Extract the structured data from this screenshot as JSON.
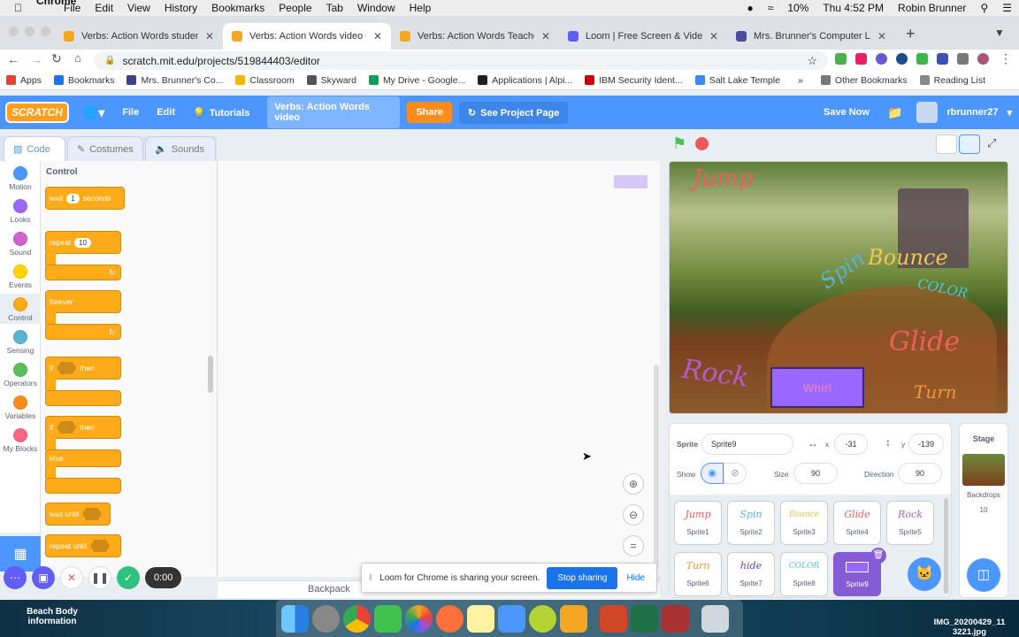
{
  "menubar": {
    "app": "Chrome",
    "items": [
      "File",
      "Edit",
      "View",
      "History",
      "Bookmarks",
      "People",
      "Tab",
      "Window",
      "Help"
    ],
    "battery": "10%",
    "clock": "Thu 4:52 PM",
    "user": "Robin Brunner"
  },
  "tabs": [
    {
      "title": "Verbs: Action Words student o",
      "color": "#f5a623"
    },
    {
      "title": "Verbs: Action Words video on",
      "color": "#f5a623"
    },
    {
      "title": "Verbs: Action Words Teacher o",
      "color": "#f5a623"
    },
    {
      "title": "Loom | Free Screen & Video Re",
      "color": "#625df5"
    },
    {
      "title": "Mrs. Brunner's Computer Lab",
      "color": "#4c4c9e"
    }
  ],
  "url": "scratch.mit.edu/projects/519844403/editor",
  "bookmarks": [
    "Apps",
    "Bookmarks",
    "Mrs. Brunner's Co...",
    "Classroom",
    "Skyward",
    "My Drive - Google...",
    "Applications | Alpi...",
    "IBM Security Ident...",
    "Salt Lake Temple",
    "Other Bookmarks",
    "Reading List"
  ],
  "scratch": {
    "logo": "SCRATCH",
    "file": "File",
    "edit": "Edit",
    "tutorials": "Tutorials",
    "project_title": "Verbs: Action Words video",
    "share": "Share",
    "see_project": "See Project Page",
    "save": "Save Now",
    "username": "rbrunner27"
  },
  "editor_tabs": {
    "code": "Code",
    "costumes": "Costumes",
    "sounds": "Sounds"
  },
  "categories": [
    {
      "label": "Motion",
      "color": "#4c97ff"
    },
    {
      "label": "Looks",
      "color": "#9966ff"
    },
    {
      "label": "Sound",
      "color": "#cf63cf"
    },
    {
      "label": "Events",
      "color": "#ffd500"
    },
    {
      "label": "Control",
      "color": "#ffab19"
    },
    {
      "label": "Sensing",
      "color": "#5cb1d6"
    },
    {
      "label": "Operators",
      "color": "#59c059"
    },
    {
      "label": "Variables",
      "color": "#ff8c1a"
    },
    {
      "label": "My Blocks",
      "color": "#ff6680"
    }
  ],
  "palette": {
    "heading": "Control",
    "wait": "wait",
    "wait_val": "1",
    "seconds": "seconds",
    "repeat": "repeat",
    "repeat_val": "10",
    "forever": "forever",
    "if": "if",
    "then": "then",
    "if2": "if",
    "then2": "then",
    "else": "else",
    "wait_until": "wait until",
    "repeat_until": "repeat until"
  },
  "backpack": "Backpack",
  "stage_words": {
    "jump": "Jump",
    "spin": "Spin",
    "bounce": "Bounce",
    "color": "COLOR",
    "rock": "Rock",
    "whirl": "Whirl",
    "glide": "Glide",
    "turn": "Turn"
  },
  "sprite_info": {
    "sprite_label": "Sprite",
    "sprite_name": "Sprite9",
    "x_label": "x",
    "x": "-31",
    "y_label": "y",
    "y": "-139",
    "show_label": "Show",
    "size_label": "Size",
    "size": "90",
    "direction_label": "Direction",
    "direction": "90"
  },
  "sprites": [
    {
      "name": "Sprite1",
      "img": "Jump",
      "color": "#e8605a"
    },
    {
      "name": "Sprite2",
      "img": "Spin",
      "color": "#5cb1d6"
    },
    {
      "name": "Sprite3",
      "img": "Bounce",
      "color": "#e8c547"
    },
    {
      "name": "Sprite4",
      "img": "Glide",
      "color": "#e8605a"
    },
    {
      "name": "Sprite5",
      "img": "Rock",
      "color": "#b45bc7"
    },
    {
      "name": "Sprite6",
      "img": "Turn",
      "color": "#e89a3c"
    },
    {
      "name": "Sprite7",
      "img": "hide",
      "color": "#6b3fa0"
    },
    {
      "name": "Sprite8",
      "img": "COLOR",
      "color": "#4ec9d6"
    },
    {
      "name": "Sprite9",
      "img": "",
      "color": "#9966ff"
    }
  ],
  "stage_panel": {
    "title": "Stage",
    "backdrops_label": "Backdrops",
    "backdrops_count": "10"
  },
  "loom": {
    "message": "Loom for Chrome is sharing your screen.",
    "stop": "Stop sharing",
    "hide": "Hide",
    "timer": "0:00"
  },
  "desktop": {
    "left_item": "Beach Body information",
    "right_item": "IMG_20200429_11 3221.jpg"
  }
}
